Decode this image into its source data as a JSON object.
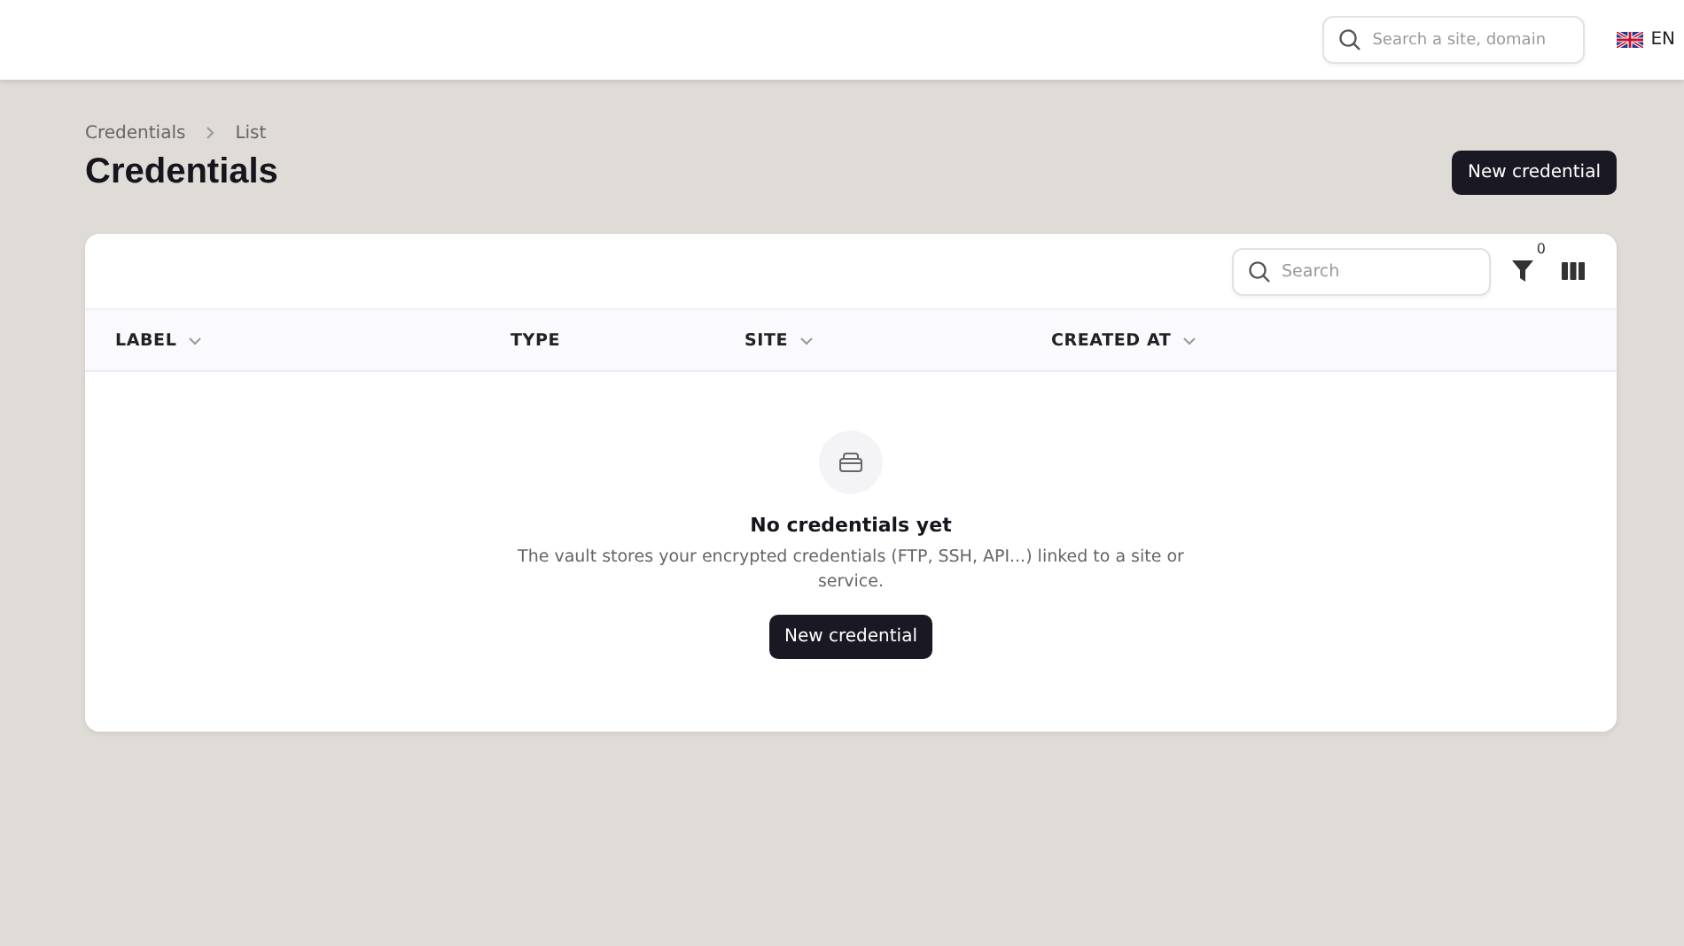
{
  "topbar": {
    "search": {
      "placeholder": "Search a site, domain"
    },
    "language": "EN"
  },
  "breadcrumb": [
    "Credentials",
    "List"
  ],
  "title": "Credentials",
  "new_button": "New credential",
  "table": {
    "search": {
      "placeholder": "Search"
    },
    "filter_count": "0",
    "columns": [
      {
        "label": "LABEL",
        "sortable": true
      },
      {
        "label": "TYPE",
        "sortable": false
      },
      {
        "label": "SITE",
        "sortable": true
      },
      {
        "label": "CREATED AT",
        "sortable": true
      }
    ],
    "empty": {
      "title": "No credentials yet",
      "text": "The vault stores your encrypted credentials (FTP, SSH, API...) linked to a site or service.",
      "button": "New credential"
    }
  }
}
